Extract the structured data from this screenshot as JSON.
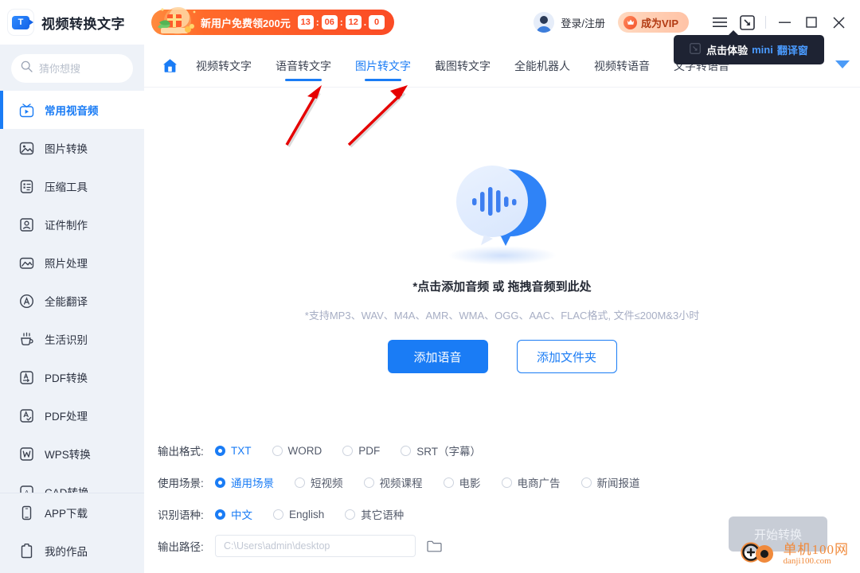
{
  "window": {
    "app_title": "视频转换文字",
    "logo_icon": "video-text-logo-icon"
  },
  "promo": {
    "text": "新用户免费领200元",
    "hours": "13",
    "minutes": "06",
    "seconds": "12",
    "tenths": "0",
    "sep": ":",
    "dot": ".",
    "gift_icon": "gift-box-icon",
    "bg_color": "#fb4b25"
  },
  "account": {
    "avatar_icon": "user-avatar-icon",
    "login_label": "登录/注册",
    "vip_label": "成为VIP",
    "vip_icon": "crown-icon"
  },
  "window_controls": {
    "menu_icon": "hamburger-menu-icon",
    "mini_window_icon": "mini-window-icon",
    "minimize_icon": "minimize-icon",
    "maximize_icon": "maximize-icon",
    "close_icon": "close-icon"
  },
  "tooltip": {
    "icon": "mini-window-icon",
    "text_prefix": "点击体验",
    "text_highlight": "mini",
    "text_suffix": "翻译窗"
  },
  "search": {
    "icon": "search-icon",
    "placeholder": "猜你想搜",
    "value": ""
  },
  "sidebar": {
    "items": [
      {
        "label": "常用视音频",
        "icon": "tv-play-icon",
        "active": true
      },
      {
        "label": "图片转换",
        "icon": "image-icon",
        "active": false
      },
      {
        "label": "压缩工具",
        "icon": "compress-icon",
        "active": false
      },
      {
        "label": "证件制作",
        "icon": "id-card-icon",
        "active": false
      },
      {
        "label": "照片处理",
        "icon": "photo-edit-icon",
        "active": false
      },
      {
        "label": "全能翻译",
        "icon": "translate-icon",
        "active": false
      },
      {
        "label": "生活识别",
        "icon": "cup-icon",
        "active": false
      },
      {
        "label": "PDF转换",
        "icon": "pdf-convert-icon",
        "active": false
      },
      {
        "label": "PDF处理",
        "icon": "pdf-edit-icon",
        "active": false
      },
      {
        "label": "WPS转换",
        "icon": "wps-icon",
        "active": false
      },
      {
        "label": "CAD转换",
        "icon": "cad-icon",
        "active": false
      }
    ],
    "bottom_items": [
      {
        "label": "APP下载",
        "icon": "mobile-phone-icon"
      },
      {
        "label": "我的作品",
        "icon": "clipboard-icon"
      }
    ]
  },
  "nav": {
    "home_icon": "home-icon",
    "more_icon": "chevron-down-icon",
    "tabs": [
      {
        "label": "视频转文字",
        "active": false,
        "underlined": false
      },
      {
        "label": "语音转文字",
        "active": false,
        "underlined": true
      },
      {
        "label": "图片转文字",
        "active": true,
        "underlined": true
      },
      {
        "label": "截图转文字",
        "active": false,
        "underlined": false
      },
      {
        "label": "全能机器人",
        "active": false,
        "underlined": false
      },
      {
        "label": "视频转语音",
        "active": false,
        "underlined": false
      },
      {
        "label": "文字转语音",
        "active": false,
        "underlined": false
      }
    ]
  },
  "main": {
    "illustration_icon": "audio-chat-bubble-icon",
    "drop_title": "*点击添加音频 或 拖拽音频到此处",
    "drop_subtitle": "*支持MP3、WAV、M4A、AMR、WMA、OGG、AAC、FLAC格式, 文件≤200M&3小时",
    "add_audio_label": "添加语音",
    "add_folder_label": "添加文件夹"
  },
  "settings": {
    "format": {
      "label": "输出格式:",
      "options": [
        {
          "label": "TXT",
          "selected": true
        },
        {
          "label": "WORD",
          "selected": false
        },
        {
          "label": "PDF",
          "selected": false
        },
        {
          "label": "SRT（字幕）",
          "selected": false
        }
      ]
    },
    "scene": {
      "label": "使用场景:",
      "options": [
        {
          "label": "通用场景",
          "selected": true
        },
        {
          "label": "短视频",
          "selected": false
        },
        {
          "label": "视频课程",
          "selected": false
        },
        {
          "label": "电影",
          "selected": false
        },
        {
          "label": "电商广告",
          "selected": false
        },
        {
          "label": "新闻报道",
          "selected": false
        }
      ]
    },
    "language": {
      "label": "识别语种:",
      "options": [
        {
          "label": "中文",
          "selected": true
        },
        {
          "label": "English",
          "selected": false
        },
        {
          "label": "其它语种",
          "selected": false
        }
      ]
    },
    "output_path": {
      "label": "输出路径:",
      "placeholder": "C:\\Users\\admin\\desktop",
      "value": "",
      "browse_icon": "folder-icon"
    },
    "start_label": "开始转换"
  },
  "annotations": {
    "arrow1_icon": "red-arrow-icon",
    "arrow2_icon": "red-arrow-icon"
  },
  "watermark": {
    "icon": "danji-logo-icon",
    "cn": "单机100网",
    "en": "danji100.com"
  },
  "colors": {
    "accent": "#1a7cf5",
    "promo": "#fb4b25",
    "sidebar_bg": "#eef2f8",
    "muted": "#a7aec4"
  }
}
